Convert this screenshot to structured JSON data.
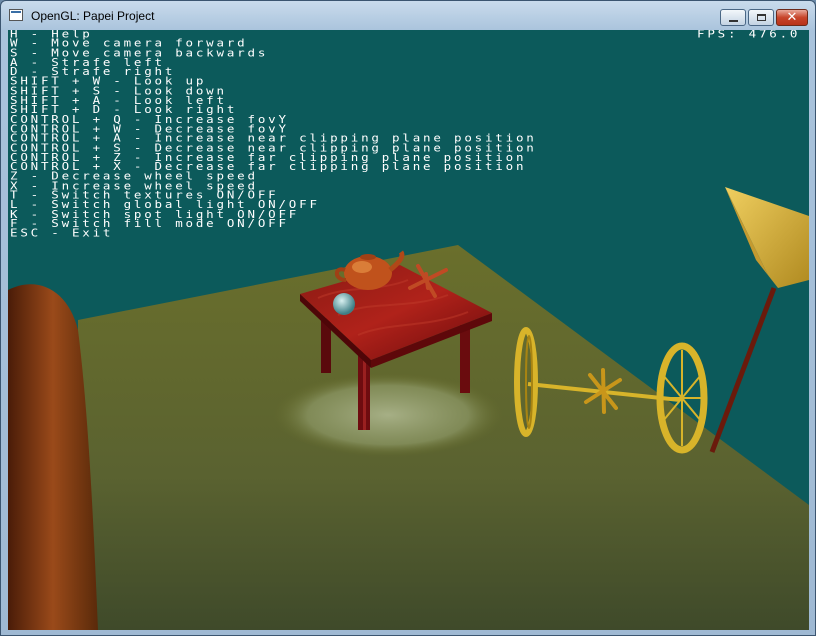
{
  "window": {
    "title": "OpenGL: Papei Project",
    "controls": {
      "minimize": "minimize",
      "maximize": "maximize",
      "close": "✕"
    }
  },
  "hud": {
    "fps": "FPS: 476.0",
    "help_lines": [
      "H - Help",
      "W - Move camera forward",
      "S - Move camera backwards",
      "A - Strafe left",
      "D - Strafe right",
      "SHIFT + W - Look up",
      "SHIFT + S - Look down",
      "SHIFT + A - Look left",
      "SHIFT + D - Look right",
      "CONTROL + Q - Increase fovY",
      "CONTROL + W - Decrease fovY",
      "CONTROL + A - Increase near clipping plane position",
      "CONTROL + S - Decrease near clipping plane position",
      "CONTROL + Z - Increase far clipping plane position",
      "CONTROL + X - Decrease far clipping plane position",
      "Z - Decrease wheel speed",
      "X - Increase wheel speed",
      "T - Switch textures ON/OFF",
      "L - Switch global light ON/OFF",
      "K - Switch spot light ON/OFF",
      "F - Switch fill mode ON/OFF",
      "ESC - Exit"
    ]
  },
  "scene": {
    "background_color": "#0c5a5b",
    "floor_color": "#6a6a2a",
    "table_color": "#7a0c10",
    "wheel_color": "#d8b42a",
    "objects": [
      "table",
      "teapot",
      "sphere",
      "jack",
      "unicycle-axle",
      "lamp",
      "floor"
    ]
  }
}
